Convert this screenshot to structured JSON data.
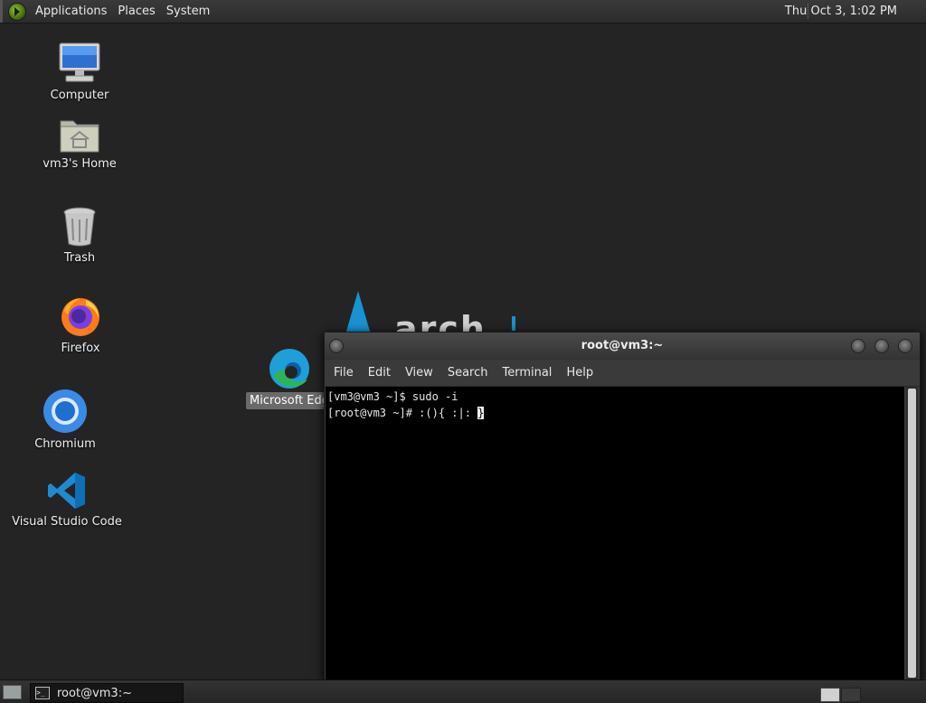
{
  "top_panel": {
    "menus": [
      "Applications",
      "Places",
      "System"
    ],
    "clock": "Thu Oct  3,  1:02 PM"
  },
  "desktop": {
    "icons": [
      {
        "label": "Computer",
        "icon": "computer-icon"
      },
      {
        "label": "vm3's Home",
        "icon": "home-folder-icon"
      },
      {
        "label": "Trash",
        "icon": "trash-icon"
      },
      {
        "label": "Firefox",
        "icon": "firefox-icon"
      },
      {
        "label": "Chromium",
        "icon": "chromium-icon"
      },
      {
        "label": "Visual Studio Code",
        "icon": "vscode-icon"
      }
    ],
    "edge_label": "Microsoft Edg"
  },
  "terminal": {
    "title": "root@vm3:~",
    "menus": [
      "File",
      "Edit",
      "View",
      "Search",
      "Terminal",
      "Help"
    ],
    "lines": [
      "[vm3@vm3 ~]$ sudo -i",
      "[root@vm3 ~]# :(){ :|: "
    ],
    "cursor_char": "}"
  },
  "bottom_panel": {
    "task_label": "root@vm3:~"
  },
  "colors": {
    "desktop_bg": "#242424",
    "panel_bg": "#2c2c2c",
    "terminal_bg": "#000000",
    "arch_blue": "#1793d1"
  }
}
